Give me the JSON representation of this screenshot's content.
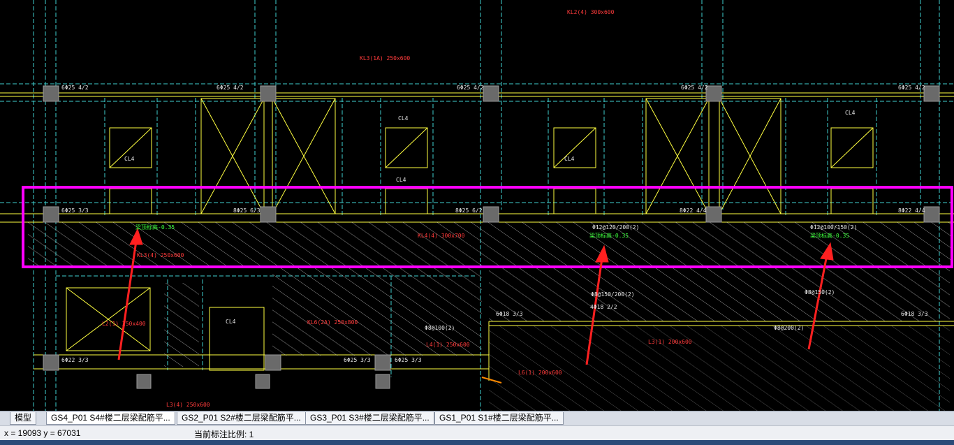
{
  "tabs": [
    {
      "label": "模型",
      "active": false
    },
    {
      "label": "GS4_P01 S4#楼二层梁配筋平...",
      "active": true
    },
    {
      "label": "GS2_P01 S2#楼二层梁配筋平...",
      "active": false
    },
    {
      "label": "GS3_P01 S3#楼二层梁配筋平...",
      "active": false
    },
    {
      "label": "GS1_P01 S1#楼二层梁配筋平...",
      "active": false
    }
  ],
  "status": {
    "coords": "x = 19093  y = 67031",
    "scale_label": "当前标注比例: 1"
  },
  "colors": {
    "background": "#000000",
    "highlight": "#ff00ff",
    "arrow": "#ff2020",
    "dim_line": "#3fd0d0",
    "beam_line": "#ffff40",
    "column": "#6a6a6a",
    "text_red": "#ff3b3b",
    "text_green": "#3cff3c"
  },
  "drawing": {
    "beam_labels": [
      "6Φ25 4/2",
      "6Φ25 4/2",
      "6Φ25 4/2",
      "6Φ25 4/2",
      "6Φ25 4/2",
      "6Φ25 3/3",
      "8Φ25 6/3",
      "8Φ25 6/2",
      "8Φ22 4/4",
      "8Φ22 4/4",
      "6Φ22 3/3",
      "6Φ25 3/3",
      "6Φ25 3/3",
      "6Φ18 3/3",
      "4Φ18 2/2",
      "6Φ18 3/3"
    ],
    "green_notes": [
      "梁顶标高-0.35",
      "梁顶标高-0.35",
      "梁顶标高-0.35"
    ],
    "stirrup_notes": [
      "Φ12@120/200(2)",
      "Φ12@100/150(2)",
      "Φ8@150/200(2)",
      "Φ8@100(2)",
      "Φ8@200(2)",
      "Φ8@150(2)"
    ],
    "beam_tags": [
      "KL3(1A) 250x600",
      "KL4(4) 300x700",
      "KL2(4) 300x600",
      "KL3(4) 250x600",
      "L3(4) 250x600",
      "KL6(2A) 250x800",
      "L3(1) 200x600",
      "L6(1) 200x600",
      "L4(1) 250x600",
      "L2(1) 250x400"
    ],
    "cl_tags": [
      "CL4",
      "CL4",
      "CL4",
      "CL4",
      "CL4",
      "CL4"
    ]
  }
}
